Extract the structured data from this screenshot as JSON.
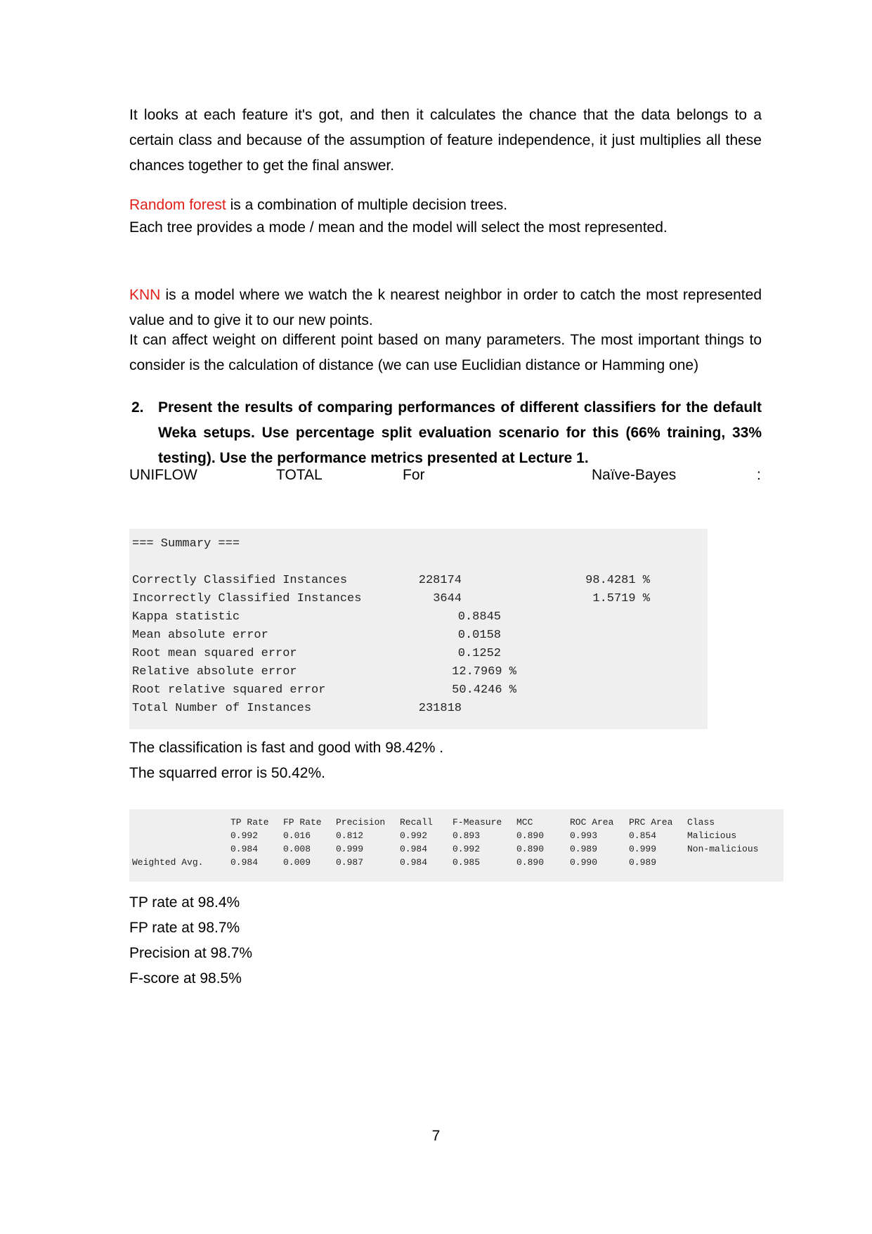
{
  "para1": "It looks at each feature it's got, and then it calculates the chance that the data belongs to a certain class and because of the assumption of feature independence, it just multiplies all these chances together to get the final answer.",
  "rf": {
    "term": "Random forest",
    "rest": " is a combination of multiple decision trees.",
    "line2": "Each tree provides a mode / mean and the model will select the most represented."
  },
  "knn": {
    "term": "KNN",
    "rest": " is a model where we watch the k nearest neighbor in order to catch the most represented value and to give it to our new points.",
    "line2": "It can affect weight on different point based on many parameters. The most important things to consider is the calculation of distance (we can use Euclidian distance or Hamming one)"
  },
  "question": {
    "number": "2.",
    "text": "Present the results of comparing performances of different classifiers for the default Weka setups. Use percentage split evaluation scenario for this (66% training, 33% testing). Use the performance metrics presented at Lecture 1."
  },
  "uniflow": {
    "c1": "UNIFLOW",
    "c2": "TOTAL",
    "c3": "For",
    "c4": "Naïve-Bayes",
    "c5": ":"
  },
  "summary": {
    "header": "=== Summary ===",
    "rows": [
      {
        "label": "Correctly Classified Instances",
        "value": "228174",
        "pct": "98.4281 %"
      },
      {
        "label": "Incorrectly Classified Instances",
        "value": "3644",
        "pct": "1.5719 %"
      },
      {
        "label": "Kappa statistic",
        "value": "0.8845",
        "pct": ""
      },
      {
        "label": "Mean absolute error",
        "value": "0.0158",
        "pct": ""
      },
      {
        "label": "Root mean squared error",
        "value": "0.1252",
        "pct": ""
      },
      {
        "label": "Relative absolute error",
        "value": "12.7969 %",
        "pct": ""
      },
      {
        "label": "Root relative squared error",
        "value": "50.4246 %",
        "pct": ""
      },
      {
        "label": "Total Number of Instances",
        "value": "231818",
        "pct": ""
      }
    ]
  },
  "note1": "The classification is fast and good with 98.42% .",
  "note2": "The squarred error is 50.42%.",
  "accuracy": {
    "headers": [
      "TP Rate",
      "FP Rate",
      "Precision",
      "Recall",
      "F-Measure",
      "MCC",
      "ROC Area",
      "PRC Area",
      "Class"
    ],
    "rows": [
      {
        "label": "",
        "cells": [
          "0.992",
          "0.016",
          "0.812",
          "0.992",
          "0.893",
          "0.890",
          "0.993",
          "0.854",
          "Malicious"
        ]
      },
      {
        "label": "",
        "cells": [
          "0.984",
          "0.008",
          "0.999",
          "0.984",
          "0.992",
          "0.890",
          "0.989",
          "0.999",
          "Non-malicious"
        ]
      },
      {
        "label": "Weighted Avg.",
        "cells": [
          "0.984",
          "0.009",
          "0.987",
          "0.984",
          "0.985",
          "0.890",
          "0.990",
          "0.989",
          ""
        ]
      }
    ]
  },
  "metrics": [
    "TP rate at 98.4%",
    "FP rate at 98.7%",
    "Precision at 98.7%",
    "F-score at 98.5%"
  ],
  "page_number": "7"
}
